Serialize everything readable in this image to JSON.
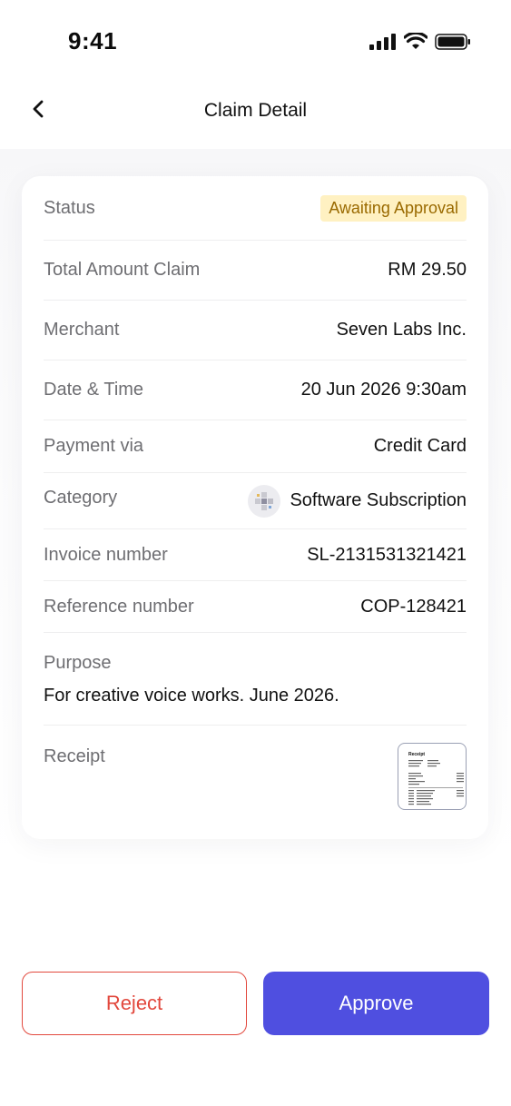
{
  "status_bar": {
    "time": "9:41"
  },
  "header": {
    "title": "Claim Detail",
    "back_icon": "chevron-left-icon"
  },
  "claim": {
    "status_label": "Status",
    "status_value": "Awaiting Approval",
    "amount_label": "Total Amount Claim",
    "amount_value": "RM 29.50",
    "merchant_label": "Merchant",
    "merchant_value": "Seven Labs Inc.",
    "datetime_label": "Date & Time",
    "datetime_value": "20 Jun 2026 9:30am",
    "payment_label": "Payment via",
    "payment_value": "Credit Card",
    "category_label": "Category",
    "category_value": "Software Subscription",
    "category_icon": "software-icon",
    "invoice_label": "Invoice number",
    "invoice_value": "SL-2131531321421",
    "reference_label": "Reference number",
    "reference_value": "COP-128421",
    "purpose_label": "Purpose",
    "purpose_value": "For creative voice works. June 2026.",
    "receipt_label": "Receipt",
    "receipt_thumb_title": "Receipt"
  },
  "actions": {
    "reject_label": "Reject",
    "approve_label": "Approve"
  },
  "colors": {
    "accent": "#4f4fe0",
    "reject": "#e2483d",
    "badge_bg": "#fff1c2",
    "badge_text": "#9a6a00"
  }
}
